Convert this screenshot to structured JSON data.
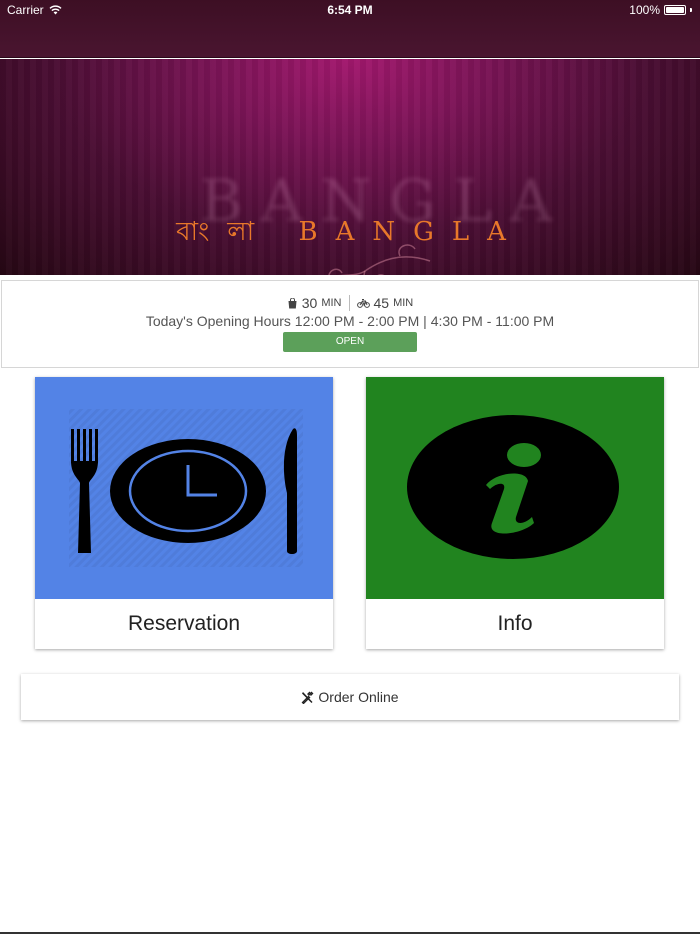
{
  "status_bar": {
    "carrier": "Carrier",
    "time": "6:54 PM",
    "battery": "100%"
  },
  "banner": {
    "logo_bengali": "বাংলা",
    "logo_latin": "BANGLA"
  },
  "delivery": {
    "collection_time": "30",
    "collection_unit": "MIN",
    "delivery_time": "45",
    "delivery_unit": "MIN",
    "opening_hours": "Today's Opening Hours 12:00 PM - 2:00 PM | 4:30 PM - 11:00 PM",
    "status_label": "OPEN"
  },
  "cards": {
    "reservation_label": "Reservation",
    "info_label": "Info"
  },
  "order": {
    "label": "Order Online"
  },
  "colors": {
    "header": "#4a1530",
    "reservation_tile": "#5383e6",
    "info_tile": "#21841f",
    "open_button": "#5ca05a",
    "logo": "#e8782a"
  },
  "icons": [
    "wifi-icon",
    "battery-icon",
    "bag-icon",
    "bike-icon",
    "fork-icon",
    "clock-plate-icon",
    "knife-icon",
    "info-icon",
    "utensils-icon"
  ]
}
